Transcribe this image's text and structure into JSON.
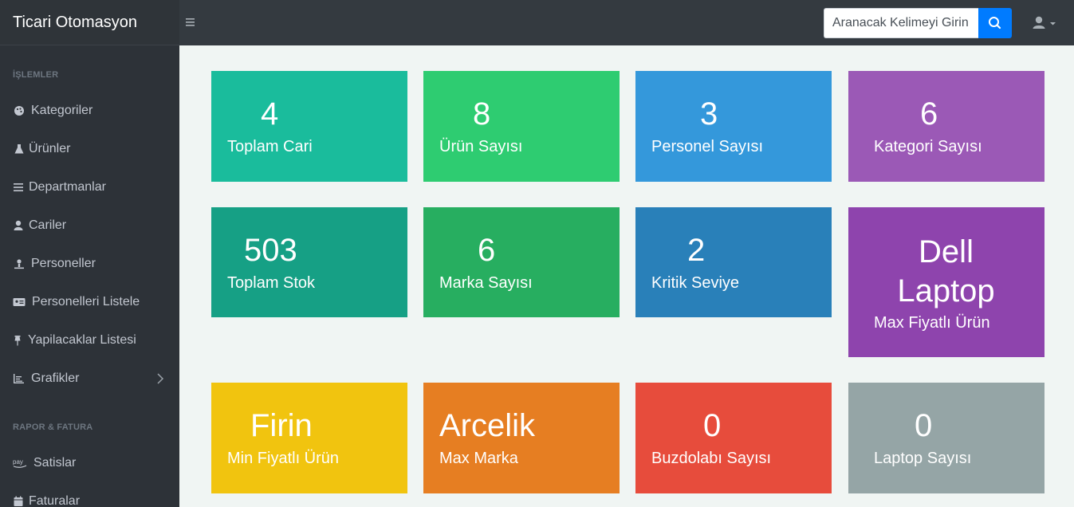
{
  "header": {
    "brand": "Ticari Otomasyon",
    "menu_icon": "hamburger-icon",
    "search_placeholder": "Aranacak Kelimeyi Girin",
    "search_icon": "search-icon",
    "user_icon": "user-icon"
  },
  "sidebar": {
    "sections": [
      {
        "title": "İŞLEMLER"
      },
      {
        "title": "RAPOR & FATURA"
      }
    ],
    "items": [
      {
        "label": "Kategoriler",
        "icon": "palette-icon"
      },
      {
        "label": "Ürünler",
        "icon": "flask-icon"
      },
      {
        "label": "Departmanlar",
        "icon": "list-icon"
      },
      {
        "label": "Cariler",
        "icon": "user-icon"
      },
      {
        "label": "Personeller",
        "icon": "worker-icon"
      },
      {
        "label": "Personelleri Listele",
        "icon": "id-card-icon"
      },
      {
        "label": "Yapilacaklar Listesi",
        "icon": "pushpin-icon"
      },
      {
        "label": "Grafikler",
        "icon": "chart-icon"
      },
      {
        "label": "Satislar",
        "icon": "pay-icon"
      },
      {
        "label": "Faturalar",
        "icon": "calendar-icon"
      }
    ]
  },
  "colors": {
    "topbar": "#343a40",
    "sidebar": "#2d3238",
    "content_bg": "#f0f5f3",
    "search_button": "#007bff"
  },
  "cards": [
    {
      "value": "4",
      "label": "Toplam Cari",
      "color": "#1abc9c"
    },
    {
      "value": "8",
      "label": "Ürün Sayısı",
      "color": "#2ecc71"
    },
    {
      "value": "3",
      "label": "Personel Sayısı",
      "color": "#3498db"
    },
    {
      "value": "6",
      "label": "Kategori Sayısı",
      "color": "#9b59b6"
    },
    {
      "value": "503",
      "label": "Toplam Stok",
      "color": "#16a085"
    },
    {
      "value": "6",
      "label": "Marka Sayısı",
      "color": "#27ae60"
    },
    {
      "value": "2",
      "label": "Kritik Seviye",
      "color": "#2980b9"
    },
    {
      "value": "Dell Laptop",
      "label": "Max Fiyatlı Ürün",
      "color": "#8e44ad"
    },
    {
      "value": "Firin",
      "label": "Min Fiyatlı Ürün",
      "color": "#f1c40f"
    },
    {
      "value": "Arcelik",
      "label": "Max Marka",
      "color": "#e67e22"
    },
    {
      "value": "0",
      "label": "Buzdolabı Sayısı",
      "color": "#e74c3c"
    },
    {
      "value": "0",
      "label": "Laptop Sayısı",
      "color": "#95a5a6"
    }
  ]
}
